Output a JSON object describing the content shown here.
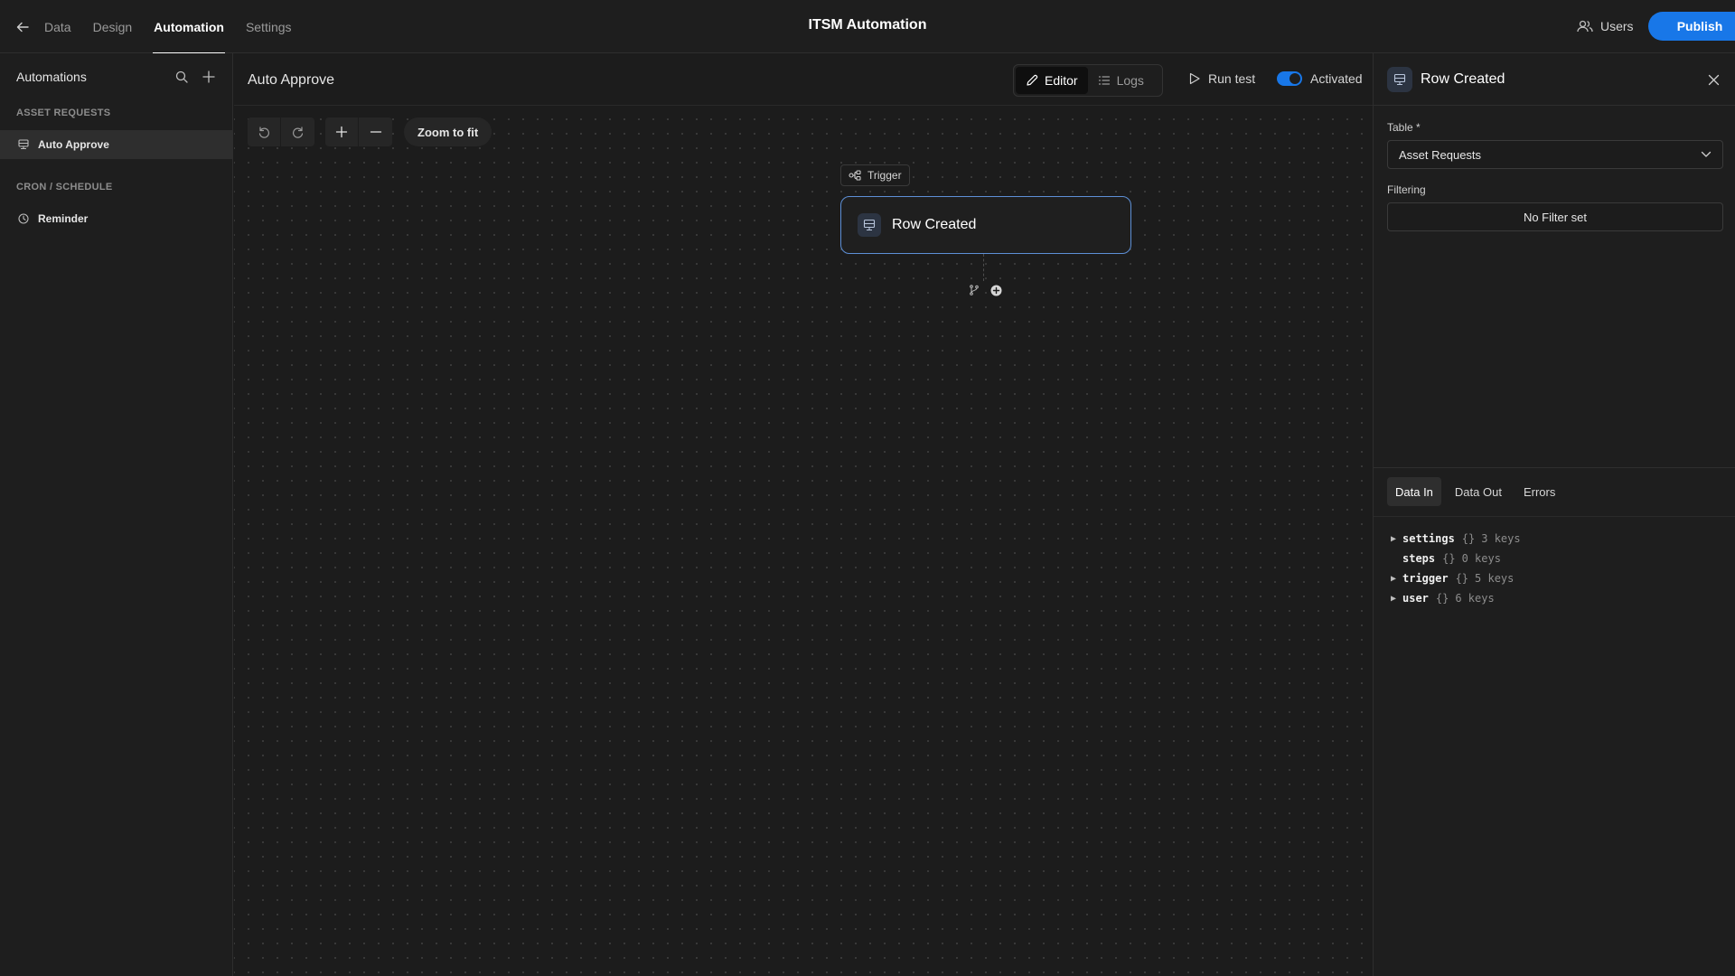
{
  "topbar": {
    "nav_tabs": [
      {
        "label": "Data"
      },
      {
        "label": "Design"
      },
      {
        "label": "Automation"
      },
      {
        "label": "Settings"
      }
    ],
    "app_title": "ITSM Automation",
    "users_label": "Users",
    "publish_label": "Publish"
  },
  "sidebar": {
    "title": "Automations",
    "sections": [
      {
        "label": "ASSET REQUESTS",
        "items": [
          {
            "label": "Auto Approve",
            "icon": "table-row-icon",
            "selected": true
          }
        ]
      },
      {
        "label": "CRON / SCHEDULE",
        "items": [
          {
            "label": "Reminder",
            "icon": "clock-icon",
            "selected": false
          }
        ]
      }
    ]
  },
  "canvas": {
    "automation_name": "Auto Approve",
    "view_tabs": [
      {
        "label": "Editor",
        "active": true
      },
      {
        "label": "Logs",
        "active": false
      }
    ],
    "run_test_label": "Run test",
    "activated_label": "Activated",
    "activated": true,
    "zoom_fit_label": "Zoom to fit",
    "trigger_chip_label": "Trigger",
    "trigger_node_label": "Row Created"
  },
  "panel": {
    "title": "Row Created",
    "table_label": "Table *",
    "table_value": "Asset Requests",
    "filtering_label": "Filtering",
    "filter_button_label": "No Filter set",
    "data_tabs": [
      {
        "label": "Data In",
        "active": true
      },
      {
        "label": "Data Out",
        "active": false
      },
      {
        "label": "Errors",
        "active": false
      }
    ],
    "data_tree": [
      {
        "key": "settings",
        "brace": "{}",
        "count": "3 keys",
        "expandable": true
      },
      {
        "key": "steps",
        "brace": "{}",
        "count": "0 keys",
        "expandable": false
      },
      {
        "key": "trigger",
        "brace": "{}",
        "count": "5 keys",
        "expandable": true
      },
      {
        "key": "user",
        "brace": "{}",
        "count": "6 keys",
        "expandable": true
      }
    ]
  },
  "colors": {
    "accent": "#1877e8",
    "background": "#1c1c1c",
    "node_border": "#5d8fd6"
  }
}
